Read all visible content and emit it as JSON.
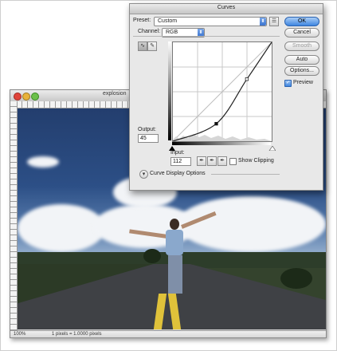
{
  "document": {
    "title": "explosion",
    "zoom": "100%",
    "status_info": "1 pixels = 1.0000 pixels"
  },
  "curves": {
    "window_title": "Curves",
    "preset_label": "Preset:",
    "preset_value": "Custom",
    "channel_label": "Channel:",
    "channel_value": "RGB",
    "output_label": "Output:",
    "output_value": "45",
    "input_label": "Input:",
    "input_value": "112",
    "show_clipping_label": "Show Clipping",
    "show_clipping_checked": false,
    "curve_display_options_label": "Curve Display Options",
    "preview_label": "Preview",
    "preview_checked": true,
    "buttons": {
      "ok": "OK",
      "cancel": "Cancel",
      "smooth": "Smooth",
      "auto": "Auto",
      "options": "Options..."
    },
    "curve_points": [
      [
        0,
        0
      ],
      [
        112,
        45
      ],
      [
        191,
        160
      ],
      [
        255,
        255
      ]
    ],
    "accent_color": "#3f86e0"
  }
}
